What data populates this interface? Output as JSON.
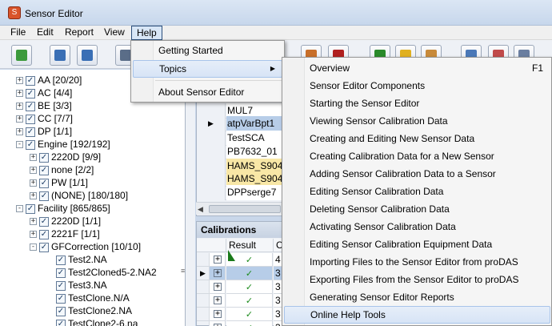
{
  "window": {
    "title": "Sensor Editor",
    "icon": "sensor-editor-app-icon"
  },
  "menubar": {
    "items": [
      {
        "label": "File"
      },
      {
        "label": "Edit"
      },
      {
        "label": "Report"
      },
      {
        "label": "View"
      },
      {
        "label": "Help"
      }
    ],
    "active": "Help"
  },
  "toolbar": {
    "buttons": [
      {
        "icon": "refresh-icon"
      },
      {
        "icon": "import-icon"
      },
      {
        "icon": "export-icon"
      },
      {
        "icon": "filter-icon"
      },
      {
        "icon": "edit-icon"
      },
      {
        "icon": "delete-icon"
      },
      {
        "icon": "flag-icon"
      },
      {
        "icon": "add-sensor-icon"
      },
      {
        "icon": "edit-sensor-icon"
      },
      {
        "icon": "table-view-icon"
      },
      {
        "icon": "chart-view-icon"
      },
      {
        "icon": "gauge-icon"
      }
    ]
  },
  "tree": {
    "nodes": [
      {
        "label": "AA [20/20]",
        "expander": "+",
        "checked": true
      },
      {
        "label": "AC [4/4]",
        "expander": "+",
        "checked": true
      },
      {
        "label": "BE [3/3]",
        "expander": "+",
        "checked": true
      },
      {
        "label": "CC [7/7]",
        "expander": "+",
        "checked": true
      },
      {
        "label": "DP [1/1]",
        "expander": "+",
        "checked": true
      },
      {
        "label": "Engine [192/192]",
        "expander": "-",
        "checked": true
      },
      {
        "label": "2220D [9/9]",
        "expander": "+",
        "checked": true
      },
      {
        "label": "none [2/2]",
        "expander": "+",
        "checked": true
      },
      {
        "label": "PW [1/1]",
        "expander": "+",
        "checked": true
      },
      {
        "label": "(NONE) [180/180]",
        "expander": "+",
        "checked": true
      },
      {
        "label": "Facility [865/865]",
        "expander": "-",
        "checked": true
      },
      {
        "label": "2220D [1/1]",
        "expander": "+",
        "checked": true
      },
      {
        "label": "2221F [1/1]",
        "expander": "+",
        "checked": true
      },
      {
        "label": "GFCorrection [10/10]",
        "expander": "-",
        "checked": true
      },
      {
        "label": "Test2.NA",
        "expander": "",
        "checked": true
      },
      {
        "label": "Test2Cloned5-2.NA2",
        "expander": "",
        "checked": true
      },
      {
        "label": "Test3.NA",
        "expander": "",
        "checked": true
      },
      {
        "label": "TestClone.N/A",
        "expander": "",
        "checked": true
      },
      {
        "label": "TestClone2.NA",
        "expander": "",
        "checked": true
      },
      {
        "label": "TestClone2-6.na",
        "expander": "",
        "checked": true
      }
    ]
  },
  "sensors": {
    "rows": [
      {
        "name": "MUL7",
        "indicator": "",
        "style": ""
      },
      {
        "name": "atpVarBpt1",
        "indicator": "▶",
        "style": "sel"
      },
      {
        "name": "TestSCA",
        "indicator": "",
        "style": ""
      },
      {
        "name": "PB7632_01",
        "indicator": "",
        "style": ""
      },
      {
        "name": "HAMS_S904A",
        "indicator": "",
        "style": "hl"
      },
      {
        "name": "HAMS_S904G",
        "indicator": "",
        "style": "hl"
      },
      {
        "name": "DPPserge7",
        "indicator": "",
        "style": ""
      }
    ]
  },
  "calibrations": {
    "header": "Calibrations",
    "columns": {
      "result": "Result",
      "next": "C"
    },
    "rows": [
      {
        "indicator": "",
        "expander": "+",
        "result": "✓",
        "value": "4",
        "selected": false
      },
      {
        "indicator": "▶",
        "expander": "+",
        "result": "✓",
        "value": "3",
        "selected": true
      },
      {
        "indicator": "",
        "expander": "+",
        "result": "✓",
        "value": "3",
        "selected": false
      },
      {
        "indicator": "",
        "expander": "+",
        "result": "✓",
        "value": "3",
        "selected": false
      },
      {
        "indicator": "",
        "expander": "+",
        "result": "✓",
        "value": "3",
        "selected": false
      },
      {
        "indicator": "",
        "expander": "+",
        "result": "✓",
        "value": "3",
        "selected": false
      }
    ]
  },
  "help_menu": {
    "items": [
      {
        "label": "Getting Started"
      },
      {
        "label": "Topics",
        "submenu": "▶"
      },
      {
        "label": "About Sensor Editor"
      }
    ]
  },
  "topics_menu": {
    "items": [
      {
        "label": "Overview",
        "shortcut": "F1"
      },
      {
        "label": "Sensor Editor Components"
      },
      {
        "label": "Starting the Sensor Editor"
      },
      {
        "label": "Viewing Sensor Calibration Data"
      },
      {
        "label": "Creating and Editing New Sensor Data"
      },
      {
        "label": "Creating Calibration Data for a New Sensor"
      },
      {
        "label": "Adding Sensor Calibration Data to a Sensor"
      },
      {
        "label": "Editing Sensor Calibration Data"
      },
      {
        "label": "Deleting Sensor Calibration Data"
      },
      {
        "label": "Activating Sensor Calibration Data"
      },
      {
        "label": "Editing Sensor Calibration Equipment Data"
      },
      {
        "label": "Importing Files to the Sensor Editor from proDAS"
      },
      {
        "label": "Exporting Files from the Sensor Editor to proDAS"
      },
      {
        "label": "Generating Sensor Editor Reports"
      },
      {
        "label": "Online Help Tools"
      }
    ]
  }
}
